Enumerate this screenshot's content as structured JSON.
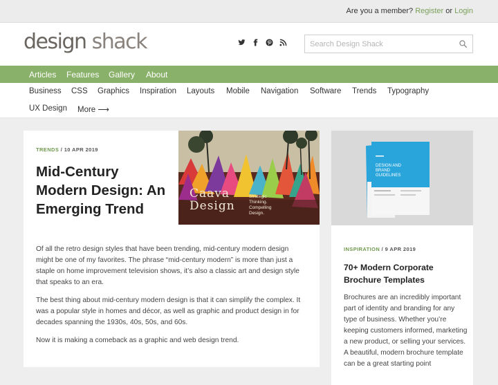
{
  "topbar": {
    "member_prompt": "Are you a member?",
    "register": "Register",
    "or": "or",
    "login": "Login"
  },
  "header": {
    "logo_word1": "design",
    "logo_word2": "shack",
    "social_icons": [
      "twitter-icon",
      "facebook-icon",
      "pinterest-icon",
      "rss-icon"
    ],
    "search_placeholder": "Search Design Shack"
  },
  "main_nav": [
    "Articles",
    "Features",
    "Gallery",
    "About"
  ],
  "sub_nav": [
    "Business",
    "CSS",
    "Graphics",
    "Inspiration",
    "Layouts",
    "Mobile",
    "Navigation",
    "Software",
    "Trends",
    "Typography",
    "UX Design",
    "More ⟶"
  ],
  "main_article": {
    "category": "TRENDS",
    "date": "/ 10 APR 2019",
    "title": "Mid-Century Modern Design: An Emerging Trend",
    "image_title": "Caava Design",
    "image_tagline": "Strategic Thinking. Compelling Design.",
    "paragraphs": [
      "Of all the retro design styles that have been trending, mid-century modern design might be one of my favorites. The phrase “mid-century modern” is more than just a staple on home improvement television shows, it’s also a classic art and design style that speaks to an era.",
      "The best thing about mid-century modern design is that it can simplify the complex. It was a popular style in homes and décor, as well as graphic and product design in for decades spanning the 1930s, 40s, 50s, and 60s.",
      "Now it is making a comeback as a graphic and web design trend."
    ]
  },
  "side_article": {
    "category": "INSPIRATION",
    "date": "/ 9 APR 2019",
    "title": "70+ Modern Corporate Brochure Templates",
    "image_text": "DESIGN AND BRAND GUIDELINES",
    "body": "Brochures are an incredibly important part of identity and branding for any type of business. Whether you’re keeping customers informed, marketing a new product, or selling your services. A beautiful, modern brochure template can be a great starting point"
  },
  "colors": {
    "accent_green": "#8ab16a",
    "category_green": "#6f9a4e",
    "brochure_blue": "#2aa5dc"
  }
}
